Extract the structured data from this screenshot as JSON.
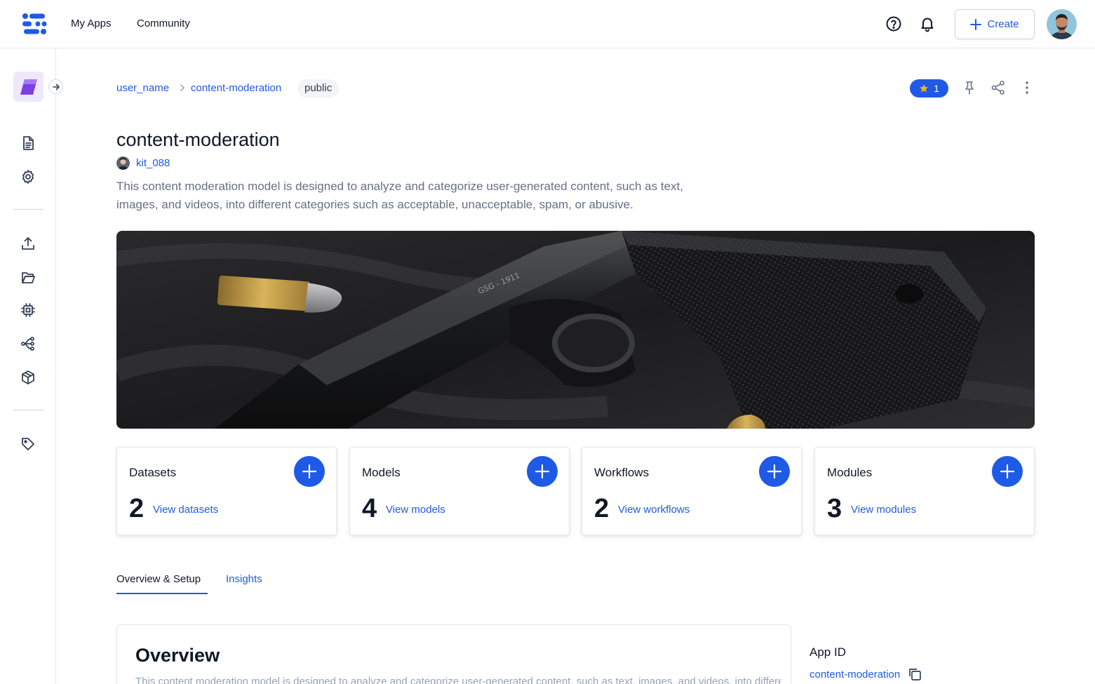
{
  "header": {
    "nav": [
      {
        "label": "My Apps"
      },
      {
        "label": "Community"
      }
    ],
    "create_label": "Create",
    "icons": [
      "help-icon",
      "bell-icon",
      "plus-icon"
    ]
  },
  "sidebar": {
    "icons": [
      "app-cube-icon",
      "arrow-right-icon",
      "document-icon",
      "settings-gear-icon",
      "upload-icon",
      "folder-icon",
      "chip-icon",
      "workflow-icon",
      "module-box-icon",
      "tag-icon"
    ]
  },
  "breadcrumb": {
    "user": "user_name",
    "app": "content-moderation",
    "visibility": "public"
  },
  "actions": {
    "star_count": "1"
  },
  "app": {
    "title": "content-moderation",
    "owner": "kit_088",
    "description": "This content moderation model is designed to analyze and categorize user-generated content, such as text, images, and videos, into different categories such as acceptable, unacceptable, spam, or abusive."
  },
  "cards": [
    {
      "title": "Datasets",
      "count": "2",
      "link": "View datasets"
    },
    {
      "title": "Models",
      "count": "4",
      "link": "View models"
    },
    {
      "title": "Workflows",
      "count": "2",
      "link": "View workflows"
    },
    {
      "title": "Modules",
      "count": "3",
      "link": "View modules"
    }
  ],
  "tabs": [
    {
      "label": "Overview & Setup",
      "active": true
    },
    {
      "label": "Insights",
      "active": false
    }
  ],
  "overview": {
    "title": "Overview",
    "text": "This content moderation model is designed to analyze and categorize user-generated content, such as text, images, and videos, into different categories such as acceptable, unacceptable, spam, or abusive."
  },
  "app_id": {
    "label": "App ID",
    "value": "content-moderation"
  },
  "colors": {
    "accent": "#1f5ae6",
    "text": "#101828",
    "muted": "#667085",
    "border": "#e4e7ec"
  }
}
